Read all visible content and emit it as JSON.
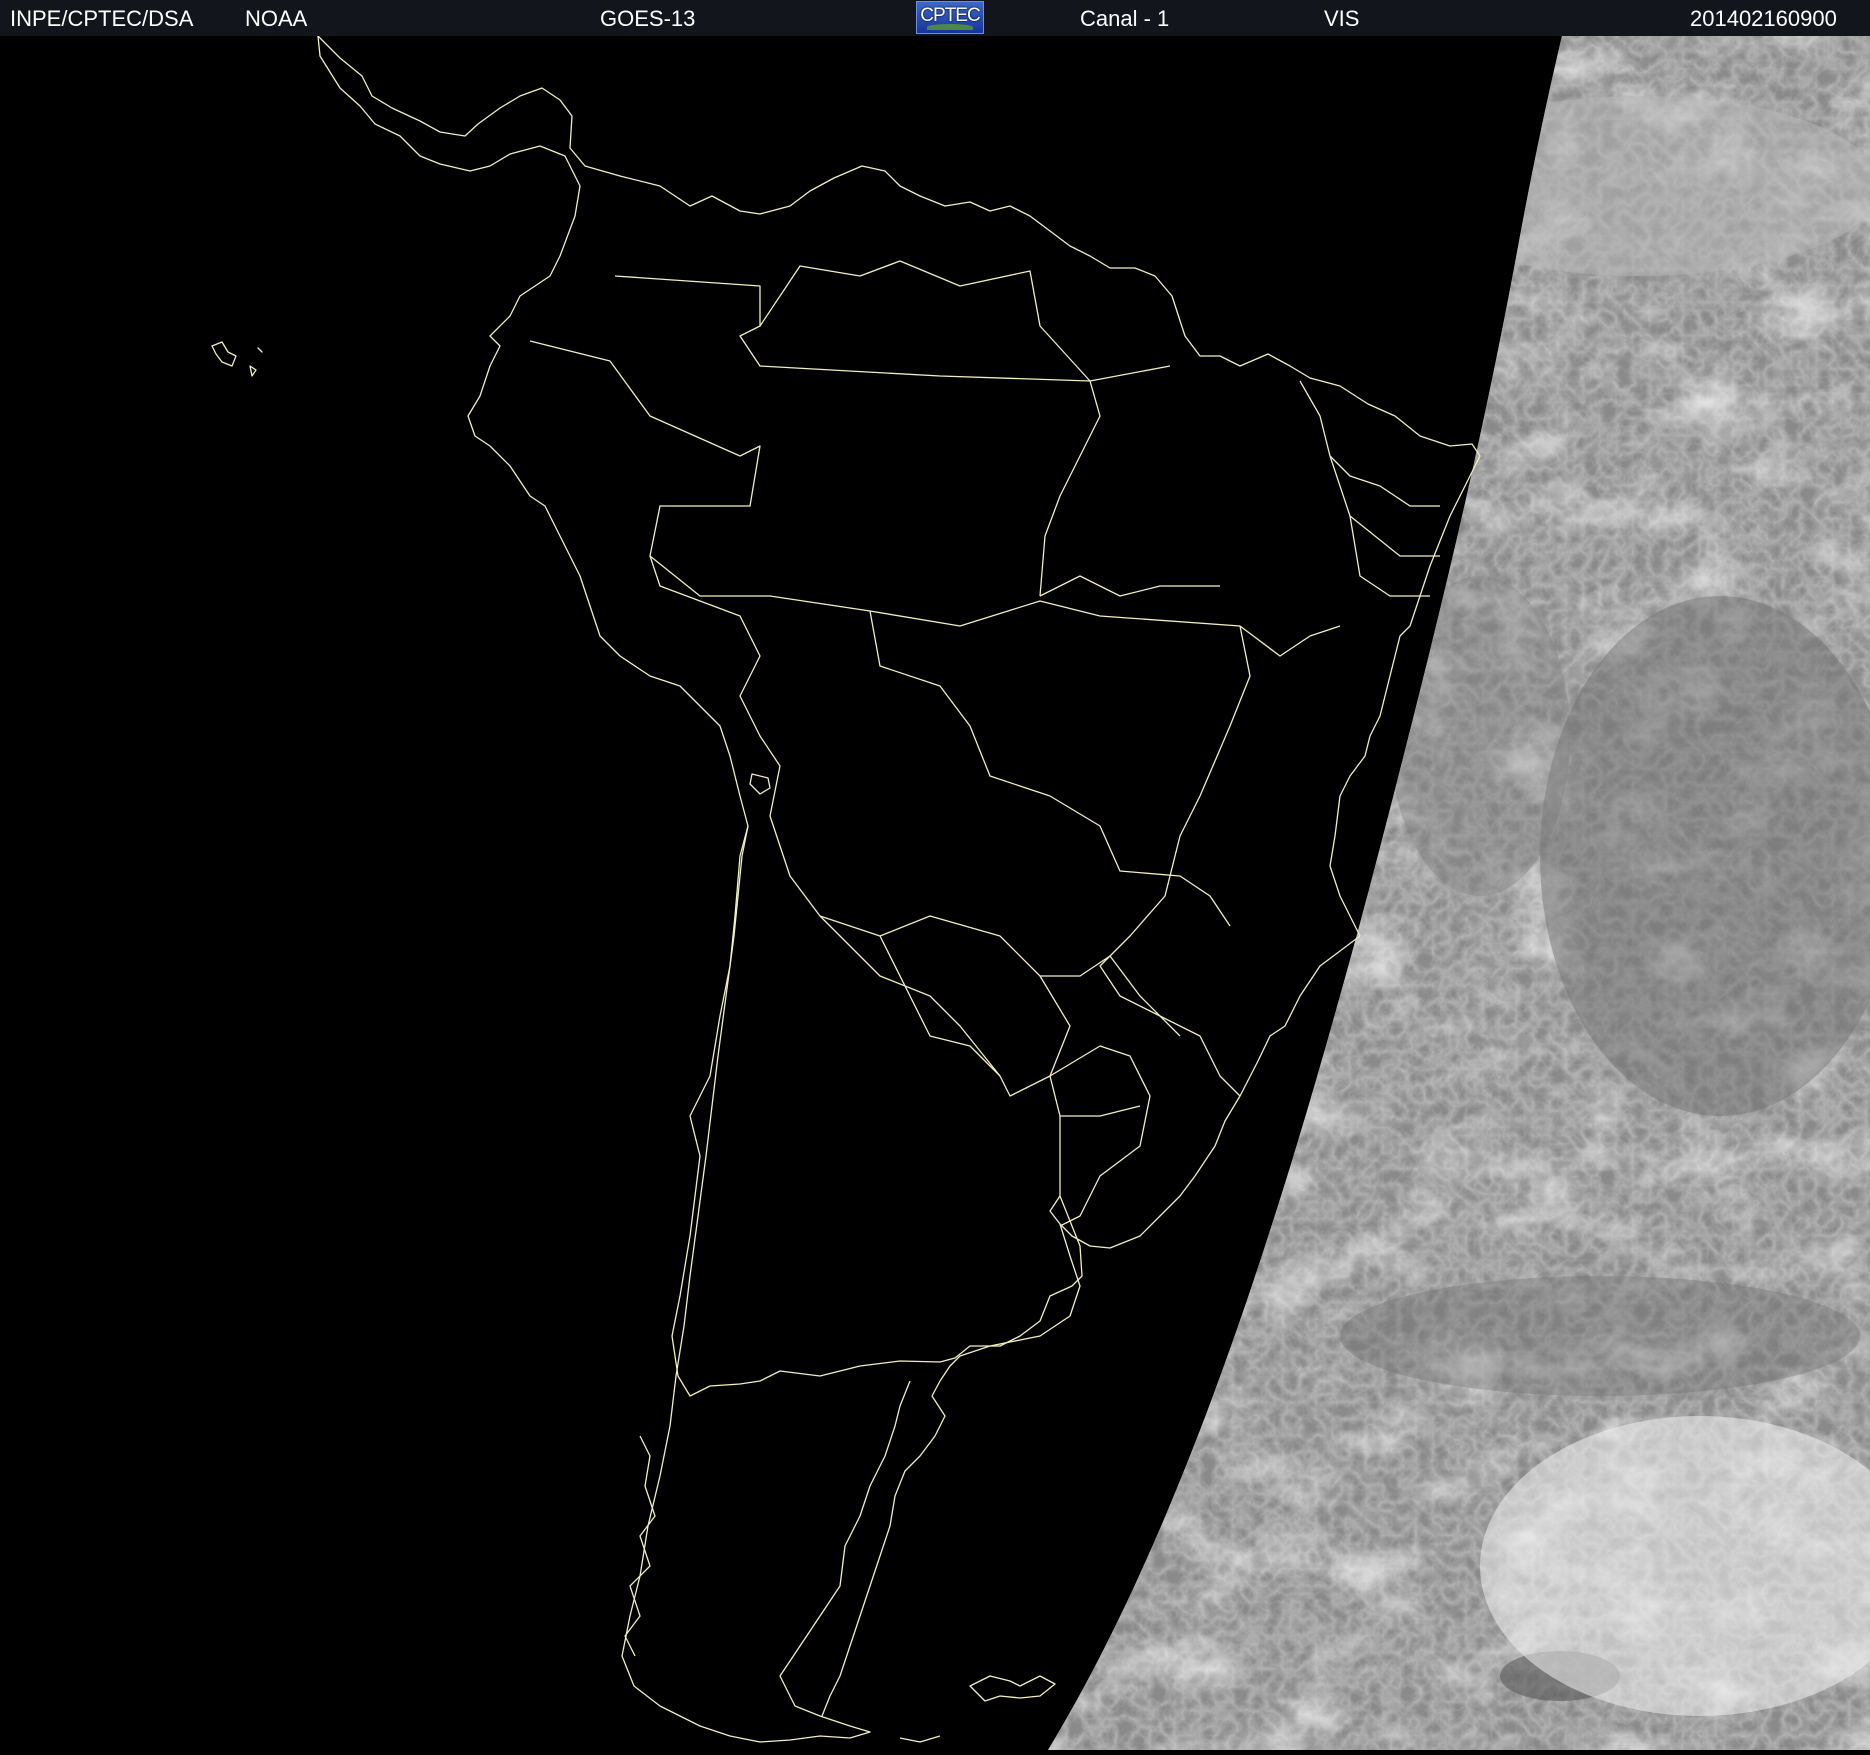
{
  "header": {
    "agency": "INPE/CPTEC/DSA",
    "source": "NOAA",
    "satellite": "GOES-13",
    "logo_text": "CPTEC",
    "channel": "Canal - 1",
    "band": "VIS",
    "datetime": "201402160900"
  },
  "colors": {
    "header_bg": "#12161c",
    "header_text": "#ffffff",
    "space_bg": "#000000",
    "coastline": "#f2eec0",
    "cloud_light": "#f2f2f2",
    "cloud_dark": "#707070"
  },
  "map": {
    "region": "South America",
    "view": "night-side with sunlit cloud field on right"
  }
}
